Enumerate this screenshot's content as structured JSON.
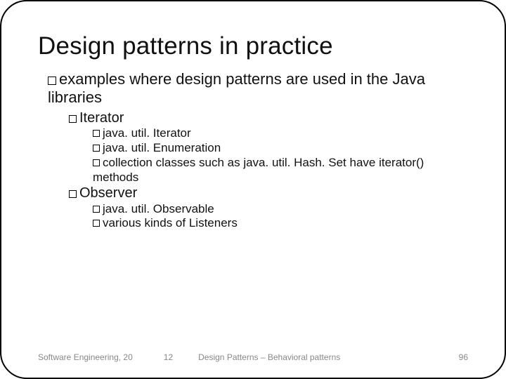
{
  "title": "Design patterns in practice",
  "bullets": {
    "l1_intro": "examples where design patterns are used in the Java libraries",
    "iterator": {
      "label": "Iterator",
      "items": [
        "java. util. Iterator",
        "java. util. Enumeration",
        "collection classes such as java. util. Hash. Set have iterator() methods"
      ]
    },
    "observer": {
      "label": "Observer",
      "items": [
        "java. util. Observable",
        "various kinds of Listeners"
      ]
    }
  },
  "footer": {
    "left": "Software Engineering, 20",
    "mid1": "12",
    "mid2": "Design Patterns – Behavioral patterns",
    "page": "96"
  }
}
